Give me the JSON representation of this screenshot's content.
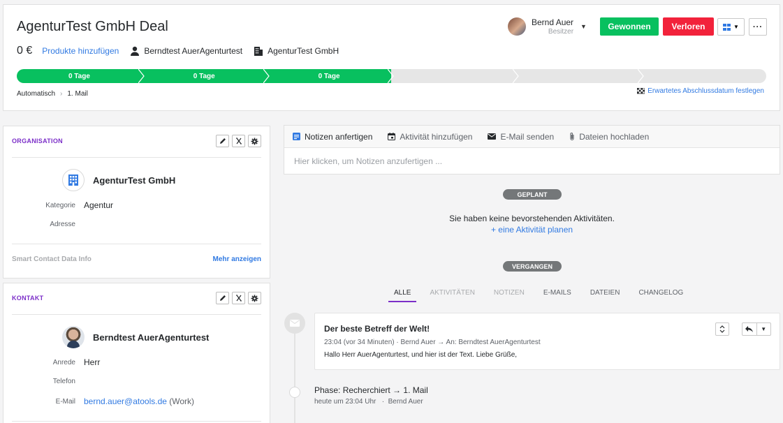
{
  "deal": {
    "title": "AgenturTest GmbH Deal",
    "value": "0 €",
    "add_products": "Produkte hinzufügen",
    "person": "Berndtest AuerAgenturtest",
    "organization": "AgenturTest GmbH",
    "owner_name": "Bernd Auer",
    "owner_role": "Besitzer"
  },
  "actions": {
    "won": "Gewonnen",
    "lost": "Verloren",
    "more": "···"
  },
  "pipeline": {
    "stages": [
      {
        "label": "0 Tage",
        "done": true
      },
      {
        "label": "0 Tage",
        "done": true
      },
      {
        "label": "0 Tage",
        "done": true
      },
      {
        "label": "",
        "done": false
      },
      {
        "label": "",
        "done": false
      },
      {
        "label": "",
        "done": false
      }
    ],
    "breadcrumb_pipeline": "Automatisch",
    "breadcrumb_stage": "1. Mail",
    "close_date_link": "Erwartetes Abschlussdatum festlegen"
  },
  "organisation_card": {
    "title": "ORGANISATION",
    "name": "AgenturTest GmbH",
    "category_label": "Kategorie",
    "category_value": "Agentur",
    "address_label": "Adresse",
    "address_value": "",
    "smart_contact": "Smart Contact Data Info",
    "more": "Mehr anzeigen"
  },
  "contact_card": {
    "title": "KONTAKT",
    "name": "Berndtest AuerAgenturtest",
    "salutation_label": "Anrede",
    "salutation_value": "Herr",
    "phone_label": "Telefon",
    "phone_value": "",
    "email_label": "E-Mail",
    "email_value": "bernd.auer@atools.de",
    "email_type": "(Work)"
  },
  "composer": {
    "tabs": [
      "Notizen anfertigen",
      "Aktivität hinzufügen",
      "E-Mail senden",
      "Dateien hochladen"
    ],
    "placeholder": "Hier klicken, um Notizen anzufertigen ..."
  },
  "planned": {
    "pill": "GEPLANT",
    "empty": "Sie haben keine bevorstehenden Aktivitäten.",
    "plan_link": "+ eine Aktivität planen"
  },
  "past": {
    "pill": "VERGANGEN",
    "filters": [
      "ALLE",
      "AKTIVITÄTEN",
      "NOTIZEN",
      "E-MAILS",
      "DATEIEN",
      "CHANGELOG"
    ]
  },
  "timeline": {
    "email": {
      "subject": "Der beste Betreff der Welt!",
      "meta": "23:04 (vor 34 Minuten) · Bernd Auer → An: Berndtest AuerAgenturtest",
      "body": "Hallo Herr AuerAgenturtest, und hier ist der Text. Liebe Grüße,"
    },
    "phase": {
      "title": "Phase: Recherchiert → 1. Mail",
      "meta": "heute um 23:04 Uhr   ·  Bernd Auer"
    }
  },
  "colors": {
    "won": "#08c05f",
    "lost": "#f2223b",
    "link": "#317ae2",
    "accent": "#7b2ec8",
    "stage_done": "#08c05f",
    "stage_todo": "#e6e6e6"
  }
}
